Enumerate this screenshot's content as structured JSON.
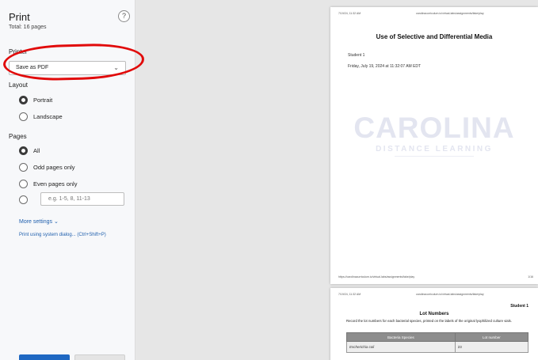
{
  "panel": {
    "title": "Print",
    "total": "Total: 16 pages",
    "help_icon": "help-icon",
    "printer_label": "Printer",
    "printer_value": "Save as PDF",
    "layout_label": "Layout",
    "layout_options": [
      "Portrait",
      "Landscape"
    ],
    "pages_label": "Pages",
    "pages_options": [
      "All",
      "Odd pages only",
      "Even pages only"
    ],
    "range_placeholder": "e.g. 1-5, 8, 11-13",
    "more_settings": "More settings",
    "more_settings_chevron": "⌄",
    "system_dialog": "Print using system dialog... (Ctrl+Shift+P)"
  },
  "preview": {
    "page1": {
      "header_left": "7/19/24, 11:32 AM",
      "header_right": "carolinacurriculum.io/virtual-labs/assignments/fake/play",
      "title": "Use of Selective and Differential Media",
      "student": "Student 1",
      "date": "Friday, July 19, 2024 at 11:32:07 AM EDT",
      "logo_main": "CAROLINA",
      "logo_sub": "DISTANCE LEARNING",
      "footer_left": "https://carolinacurriculum.io/virtual-labs/assignments/fake/play",
      "footer_right": "1/16"
    },
    "page2": {
      "header_left": "7/19/24, 11:32 AM",
      "header_right": "carolinacurriculum.io/virtual-labs/assignments/fake/play",
      "student": "Student 1",
      "heading": "Lot Numbers",
      "instructions": "Record the lot numbers for each bacterial species, printed on the labels of the original lyophilized culture vials.",
      "table_headers": [
        "Bacteria Species",
        "Lot number"
      ],
      "table_rows": [
        [
          "Escherichia coli",
          "23"
        ]
      ]
    }
  },
  "colors": {
    "accent": "#1f68c2",
    "link": "#1f5fad",
    "annotation": "#e10a0a"
  }
}
